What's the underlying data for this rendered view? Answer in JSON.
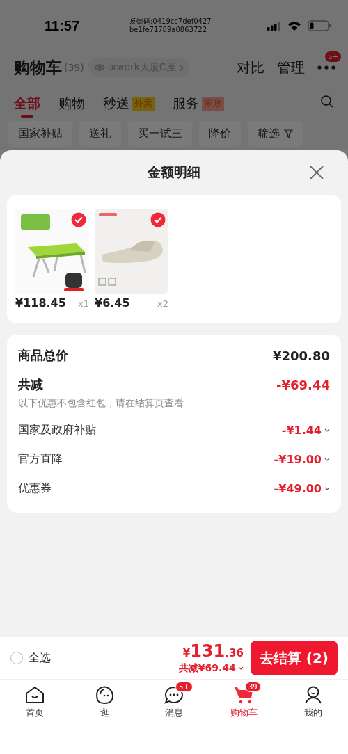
{
  "status_bar": {
    "time": "11:57",
    "feedback_code": [
      "反馈码:0419cc7def0427",
      "be1fe71789a0863722"
    ]
  },
  "header": {
    "title": "购物车",
    "count": "(39)",
    "location": "ixwork大厦C座",
    "actions": [
      "对比",
      "管理"
    ],
    "more_badge": "5+"
  },
  "tabs": [
    {
      "label": "全部",
      "selected": true
    },
    {
      "label": "购物",
      "selected": false
    },
    {
      "label": "秒送",
      "tag": "外卖",
      "color": "#76650d",
      "selected": false
    },
    {
      "label": "服务",
      "tag": "家政",
      "color": "#75504d",
      "selected": false
    }
  ],
  "filters": [
    {
      "label": "国家补贴",
      "kind": "chip"
    },
    {
      "label": "送礼",
      "kind": "chip"
    },
    {
      "label": "买一试三",
      "kind": "chip"
    },
    {
      "label": "降价",
      "kind": "chip"
    },
    {
      "label": "筛选",
      "kind": "filter"
    }
  ],
  "sheet": {
    "title": "金额明细",
    "products": [
      {
        "kind": "table",
        "price": "¥118.45",
        "quantity": "x1",
        "selected": true
      },
      {
        "kind": "slipper",
        "price": "¥6.45",
        "quantity": "x2",
        "selected": true
      }
    ],
    "total_label": "商品总价",
    "total_value": "¥200.80",
    "reduction_label": "共减",
    "reduction_value": "-¥69.44",
    "note": "以下优惠不包含红包，请在结算页查看",
    "discounts": [
      {
        "label": "国家及政府补贴",
        "amount": "-¥1.44"
      },
      {
        "label": "官方直降",
        "amount": "-¥19.00"
      },
      {
        "label": "优惠券",
        "amount": "-¥49.00"
      }
    ]
  },
  "checkout_bar": {
    "select_all": {
      "label": "全选",
      "checked": false
    },
    "currency": "¥",
    "integer": "131",
    "decimal": ".36",
    "saving": "共减¥69.44",
    "button": "去结算 (2)"
  },
  "tab_bar": [
    {
      "label": "首页",
      "kind": "home",
      "selected": false
    },
    {
      "label": "逛",
      "kind": "face",
      "selected": false
    },
    {
      "label": "消息",
      "kind": "chat",
      "badge": "5+",
      "selected": false
    },
    {
      "label": "购物车",
      "kind": "cart",
      "badge": "39",
      "selected": true
    },
    {
      "label": "我的",
      "kind": "person",
      "selected": false
    }
  ]
}
